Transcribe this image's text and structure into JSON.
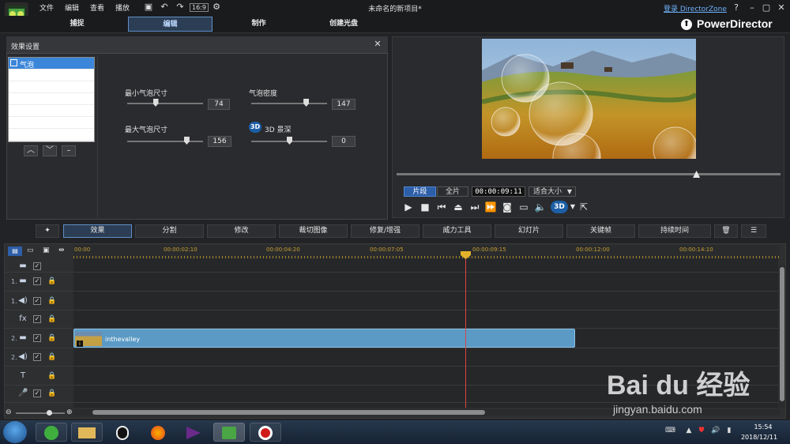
{
  "window": {
    "title": "未命名的新项目*",
    "menu": [
      "文件",
      "编辑",
      "查看",
      "播放"
    ],
    "login_link": "登录 DirectorZone",
    "zoom_badge": "16:9"
  },
  "mode_tabs": [
    "捕捉",
    "编辑",
    "制作",
    "创建光盘"
  ],
  "brand": "PowerDirector",
  "effect_panel": {
    "title": "效果设置",
    "list_items": [
      "气泡"
    ],
    "params": {
      "min_bubble_size": {
        "label": "最小气泡尺寸",
        "value": "74",
        "level": 0.37
      },
      "bubble_density": {
        "label": "气泡密度",
        "value": "147",
        "level": 0.72
      },
      "max_bubble_size": {
        "label": "最大气泡尺寸",
        "value": "156",
        "level": 0.78
      },
      "depth_3d": {
        "label": "3D 景深",
        "badge": "3D",
        "value": "0",
        "level": 0.5
      }
    }
  },
  "preview": {
    "segment_tabs": [
      "片段",
      "全片"
    ],
    "timecode": "00:00:09:11",
    "fit_select": "适合大小",
    "scrub_level": 0.78
  },
  "toolbar": [
    "效果",
    "分割",
    "修改",
    "裁切图像",
    "修复/增强",
    "威力工具",
    "幻灯片",
    "关键帧",
    "持续时间"
  ],
  "timeline": {
    "ruler_labels": [
      "00:00",
      "00:00:02:10",
      "00:00:04:20",
      "00:00:07:05",
      "00:00:09:15",
      "00:00:12:00",
      "00:00:14:10"
    ],
    "tracks": [
      {
        "num": "",
        "icon": "video-icon"
      },
      {
        "num": "1.",
        "icon": "video-icon"
      },
      {
        "num": "1.",
        "icon": "audio-icon"
      },
      {
        "num": "",
        "icon": "fx-icon",
        "glyph": "fx"
      },
      {
        "num": "2.",
        "icon": "video-icon"
      },
      {
        "num": "2.",
        "icon": "audio-icon"
      },
      {
        "num": "",
        "icon": "text-icon",
        "glyph": "T"
      },
      {
        "num": "",
        "icon": "mic-icon"
      }
    ],
    "clip": {
      "label": "inthevalley"
    }
  },
  "taskbar": {
    "time": "15:54",
    "date": "2018/12/11"
  },
  "watermark": {
    "logo": "Bai du 经验",
    "url": "jingyan.baidu.com"
  }
}
